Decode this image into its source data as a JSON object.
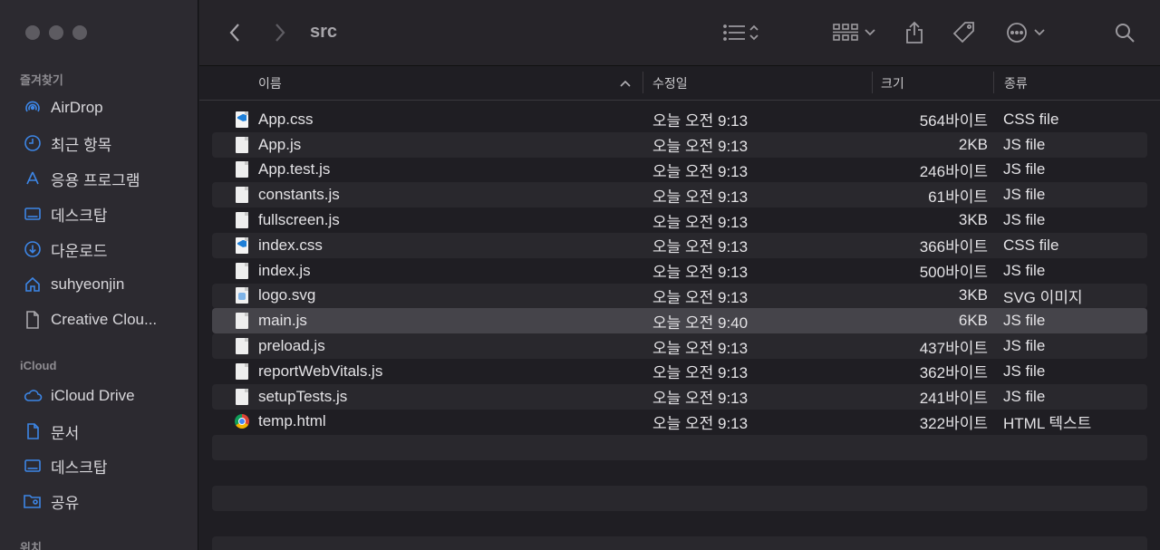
{
  "window": {
    "folder_title": "src"
  },
  "sidebar": {
    "favorites_header": "즐겨찾기",
    "favorites": [
      {
        "label": "AirDrop",
        "icon": "airdrop-icon"
      },
      {
        "label": "최근 항목",
        "icon": "clock-icon"
      },
      {
        "label": "응용 프로그램",
        "icon": "applications-icon"
      },
      {
        "label": "데스크탑",
        "icon": "desktop-icon"
      },
      {
        "label": "다운로드",
        "icon": "download-icon"
      },
      {
        "label": "suhyeonjin",
        "icon": "home-icon"
      },
      {
        "label": "Creative Clou...",
        "icon": "document-icon"
      }
    ],
    "icloud_header": "iCloud",
    "icloud": [
      {
        "label": "iCloud Drive",
        "icon": "cloud-icon"
      },
      {
        "label": "문서",
        "icon": "document-icon"
      },
      {
        "label": "데스크탑",
        "icon": "desktop-icon"
      },
      {
        "label": "공유",
        "icon": "shared-folder-icon"
      }
    ],
    "locations_header": "위치"
  },
  "columns": {
    "name": "이름",
    "date": "수정일",
    "size": "크기",
    "kind": "종류"
  },
  "files": [
    {
      "name": "App.css",
      "date": "오늘 오전 9:13",
      "size": "564바이트",
      "kind": "CSS file",
      "type": "css"
    },
    {
      "name": "App.js",
      "date": "오늘 오전 9:13",
      "size": "2KB",
      "kind": "JS file",
      "type": "js"
    },
    {
      "name": "App.test.js",
      "date": "오늘 오전 9:13",
      "size": "246바이트",
      "kind": "JS file",
      "type": "js"
    },
    {
      "name": "constants.js",
      "date": "오늘 오전 9:13",
      "size": "61바이트",
      "kind": "JS file",
      "type": "js"
    },
    {
      "name": "fullscreen.js",
      "date": "오늘 오전 9:13",
      "size": "3KB",
      "kind": "JS file",
      "type": "js"
    },
    {
      "name": "index.css",
      "date": "오늘 오전 9:13",
      "size": "366바이트",
      "kind": "CSS file",
      "type": "css"
    },
    {
      "name": "index.js",
      "date": "오늘 오전 9:13",
      "size": "500바이트",
      "kind": "JS file",
      "type": "js"
    },
    {
      "name": "logo.svg",
      "date": "오늘 오전 9:13",
      "size": "3KB",
      "kind": "SVG 이미지",
      "type": "svg"
    },
    {
      "name": "main.js",
      "date": "오늘 오전 9:40",
      "size": "6KB",
      "kind": "JS file",
      "type": "js",
      "selected": true
    },
    {
      "name": "preload.js",
      "date": "오늘 오전 9:13",
      "size": "437바이트",
      "kind": "JS file",
      "type": "js"
    },
    {
      "name": "reportWebVitals.js",
      "date": "오늘 오전 9:13",
      "size": "362바이트",
      "kind": "JS file",
      "type": "js"
    },
    {
      "name": "setupTests.js",
      "date": "오늘 오전 9:13",
      "size": "241바이트",
      "kind": "JS file",
      "type": "js"
    },
    {
      "name": "temp.html",
      "date": "오늘 오전 9:13",
      "size": "322바이트",
      "kind": "HTML 텍스트",
      "type": "chrome"
    }
  ],
  "colors": {
    "accent": "#3d86e6",
    "selection": "#45444a"
  }
}
